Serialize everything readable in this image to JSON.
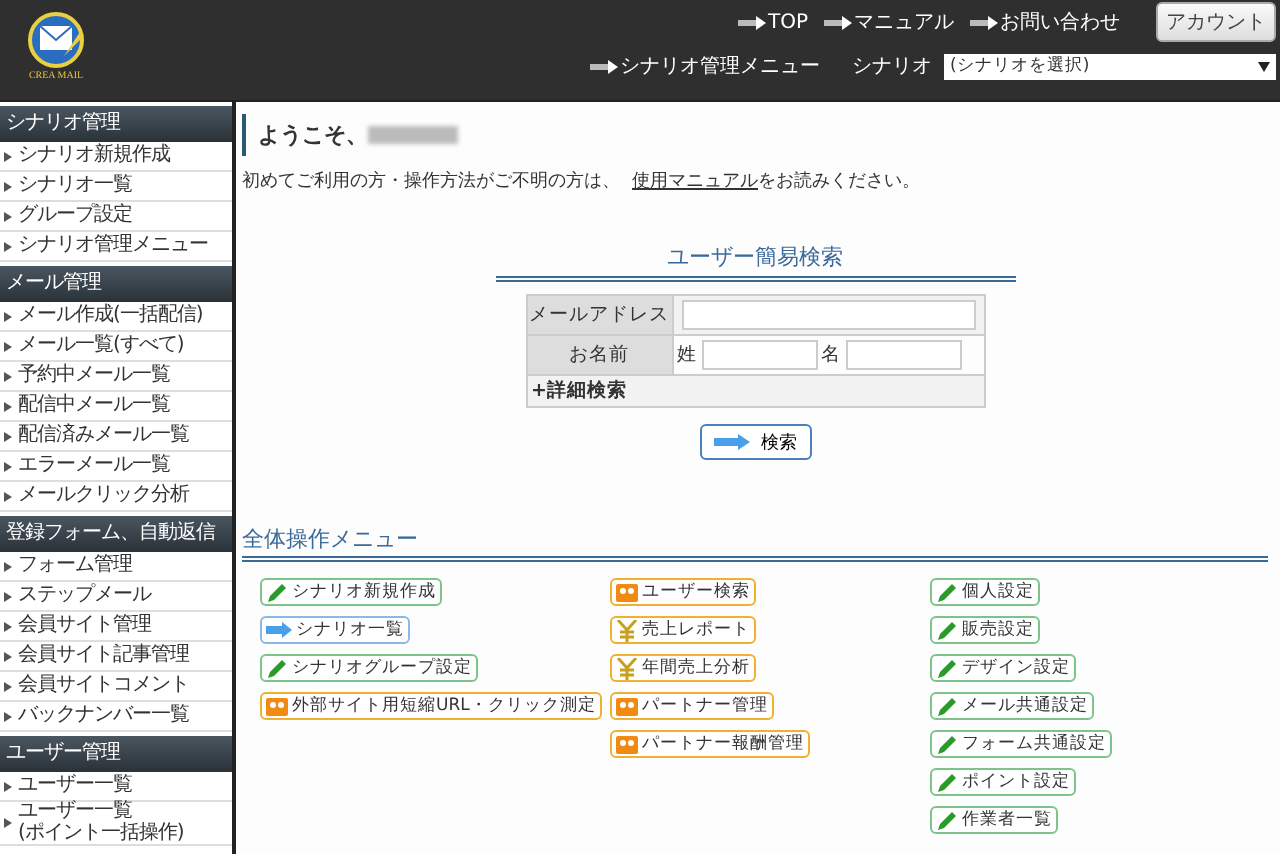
{
  "header": {
    "logo_text": "CREA MAIL",
    "links": [
      "TOP",
      "マニュアル",
      "お問い合わせ"
    ],
    "account_button": "アカウント",
    "menu_link": "シナリオ管理メニュー",
    "scenario_label": "シナリオ",
    "scenario_select": "(シナリオを選択)"
  },
  "sidebar": [
    {
      "title": "シナリオ管理",
      "items": [
        "シナリオ新規作成",
        "シナリオ一覧",
        "グループ設定",
        "シナリオ管理メニュー"
      ]
    },
    {
      "title": "メール管理",
      "items": [
        "メール作成(一括配信)",
        "メール一覧(すべて)",
        "予約中メール一覧",
        "配信中メール一覧",
        "配信済みメール一覧",
        "エラーメール一覧",
        "メールクリック分析"
      ]
    },
    {
      "title": "登録フォーム、自動返信",
      "items": [
        "フォーム管理",
        "ステップメール",
        "会員サイト管理",
        "会員サイト記事管理",
        "会員サイトコメント",
        "バックナンバー一覧"
      ]
    },
    {
      "title": "ユーザー管理",
      "items": [
        "ユーザー一覧",
        "ユーザー一覧\n(ポイント一括操作)"
      ]
    }
  ],
  "welcome": "ようこそ、",
  "intro": {
    "before": "初めてご利用の方・操作方法がご不明の方は、",
    "link": "使用マニュアル",
    "after": "をお読みください。"
  },
  "search": {
    "title": "ユーザー簡易検索",
    "email_label": "メールアドレス",
    "name_label": "お名前",
    "last_name_label": "姓",
    "first_name_label": "名",
    "advanced": "+詳細検索",
    "button": "検索"
  },
  "menu": {
    "title": "全体操作メニュー",
    "columns": [
      [
        {
          "label": "シナリオ新規作成",
          "kind": "edit"
        },
        {
          "label": "シナリオ一覧",
          "kind": "list"
        },
        {
          "label": "シナリオグループ設定",
          "kind": "edit"
        },
        {
          "label": "外部サイト用短縮URL・クリック測定",
          "kind": "tool"
        }
      ],
      [
        {
          "label": "ユーザー検索",
          "kind": "tool"
        },
        {
          "label": "売上レポート",
          "kind": "money"
        },
        {
          "label": "年間売上分析",
          "kind": "money"
        },
        {
          "label": "パートナー管理",
          "kind": "tool"
        },
        {
          "label": "パートナー報酬管理",
          "kind": "tool"
        }
      ],
      [
        {
          "label": "個人設定",
          "kind": "edit"
        },
        {
          "label": "販売設定",
          "kind": "edit"
        },
        {
          "label": "デザイン設定",
          "kind": "edit"
        },
        {
          "label": "メール共通設定",
          "kind": "edit"
        },
        {
          "label": "フォーム共通設定",
          "kind": "edit"
        },
        {
          "label": "ポイント設定",
          "kind": "edit"
        },
        {
          "label": "作業者一覧",
          "kind": "edit"
        }
      ]
    ]
  }
}
